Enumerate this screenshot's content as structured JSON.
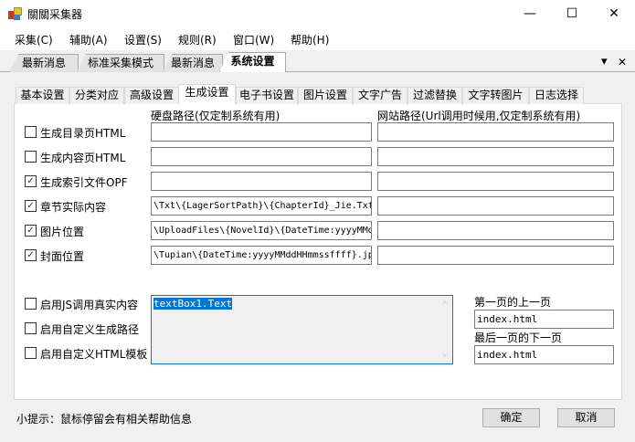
{
  "window": {
    "title": "關關采集器",
    "minimize": "—",
    "maximize": "☐",
    "close": "✕"
  },
  "menu": [
    "采集(C)",
    "辅助(A)",
    "设置(S)",
    "规则(R)",
    "窗口(W)",
    "帮助(H)"
  ],
  "outer_tabs": [
    "最新消息",
    "标准采集模式",
    "最新消息",
    "系统设置"
  ],
  "outer_controls": {
    "dropdown": "▾",
    "close": "✕"
  },
  "inner_tabs": [
    "基本设置",
    "分类对应",
    "高级设置",
    "生成设置",
    "电子书设置",
    "图片设置",
    "文字广告",
    "过滤替换",
    "文字转图片",
    "日志选择"
  ],
  "headers": {
    "disk": "硬盘路径(仅定制系统有用)",
    "web": "网站路径(Url调用时候用,仅定制系统有用)"
  },
  "rows": [
    {
      "label": "生成目录页HTML",
      "checked": false,
      "disk": "",
      "web": ""
    },
    {
      "label": "生成内容页HTML",
      "checked": false,
      "disk": "",
      "web": ""
    },
    {
      "label": "生成索引文件OPF",
      "checked": true,
      "disk": "",
      "web": ""
    },
    {
      "label": "章节实际内容",
      "checked": true,
      "disk": "\\Txt\\{LagerSortPath}\\{ChapterId}_Jie.Txt",
      "web": ""
    },
    {
      "label": "图片位置",
      "checked": true,
      "disk": "\\UploadFiles\\{NovelId}\\{DateTime:yyyyMMdd",
      "web": ""
    },
    {
      "label": "封面位置",
      "checked": true,
      "disk": "\\Tupian\\{DateTime:yyyyMMddHHmmssffff}.jpg",
      "web": ""
    }
  ],
  "options": [
    {
      "label": "启用JS调用真实内容",
      "checked": false
    },
    {
      "label": "启用自定义生成路径",
      "checked": false
    },
    {
      "label": "启用自定义HTML模板",
      "checked": false
    }
  ],
  "textarea": {
    "value": "textBox1.Text",
    "scroll_up": "˄",
    "scroll_down": "˅"
  },
  "first_prev": {
    "label": "第一页的上一页",
    "value": "index.html"
  },
  "last_next": {
    "label": "最后一页的下一页",
    "value": "index.html"
  },
  "hint": "小提示：鼠标停留会有相关帮助信息",
  "buttons": {
    "ok": "确定",
    "cancel": "取消"
  },
  "check_glyph": "✓"
}
